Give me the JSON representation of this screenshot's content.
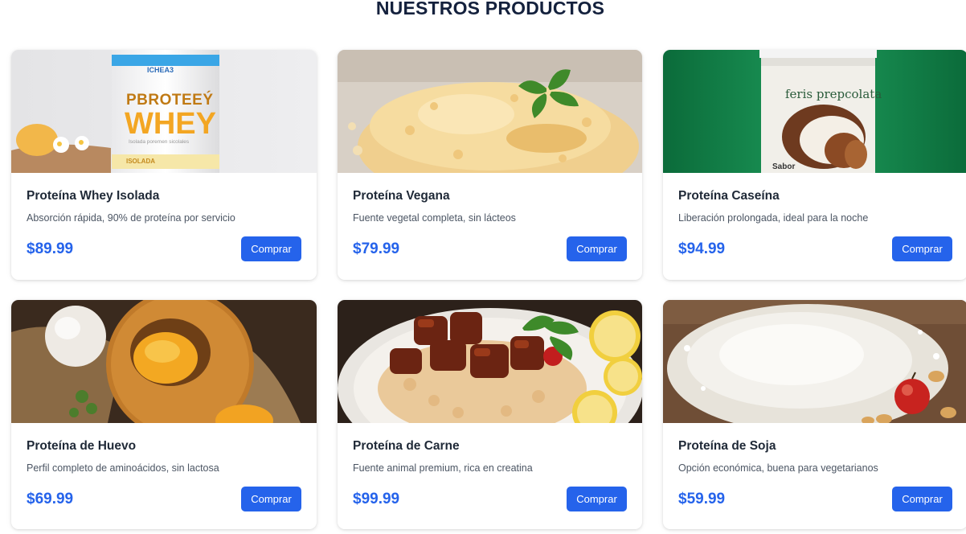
{
  "section": {
    "title": "NUESTROS PRODUCTOS"
  },
  "buy_label": "Comprar",
  "colors": {
    "accent": "#2563eb",
    "title": "#14213d"
  },
  "products": [
    {
      "name": "Proteína Whey Isolada",
      "description": "Absorción rápida, 90% de proteína por servicio",
      "price": "$89.99",
      "image": {
        "subject": "whey-tub",
        "brand": "ICHEA3",
        "headline": "PBROTEEÝ",
        "word": "WHEY",
        "subtext": "Isolada poremen sicolales",
        "badge": "ISOLADA"
      }
    },
    {
      "name": "Proteína Vegana",
      "description": "Fuente vegetal completa, sin lácteos",
      "price": "$79.99",
      "image": {
        "subject": "vegan-grains"
      }
    },
    {
      "name": "Proteína Caseína",
      "description": "Liberación prolongada, ideal para la noche",
      "price": "$94.99",
      "image": {
        "subject": "casein-tub",
        "label": "feris prepcolata",
        "corner_text": "Sabor"
      }
    },
    {
      "name": "Proteína de Huevo",
      "description": "Perfil completo de aminoácidos, sin lactosa",
      "price": "$69.99",
      "image": {
        "subject": "egg-bread"
      }
    },
    {
      "name": "Proteína de Carne",
      "description": "Fuente animal premium, rica en creatina",
      "price": "$99.99",
      "image": {
        "subject": "beef-plate"
      }
    },
    {
      "name": "Proteína de Soja",
      "description": "Opción económica, buena para vegetarianos",
      "price": "$59.99",
      "image": {
        "subject": "soy-powder"
      }
    }
  ]
}
